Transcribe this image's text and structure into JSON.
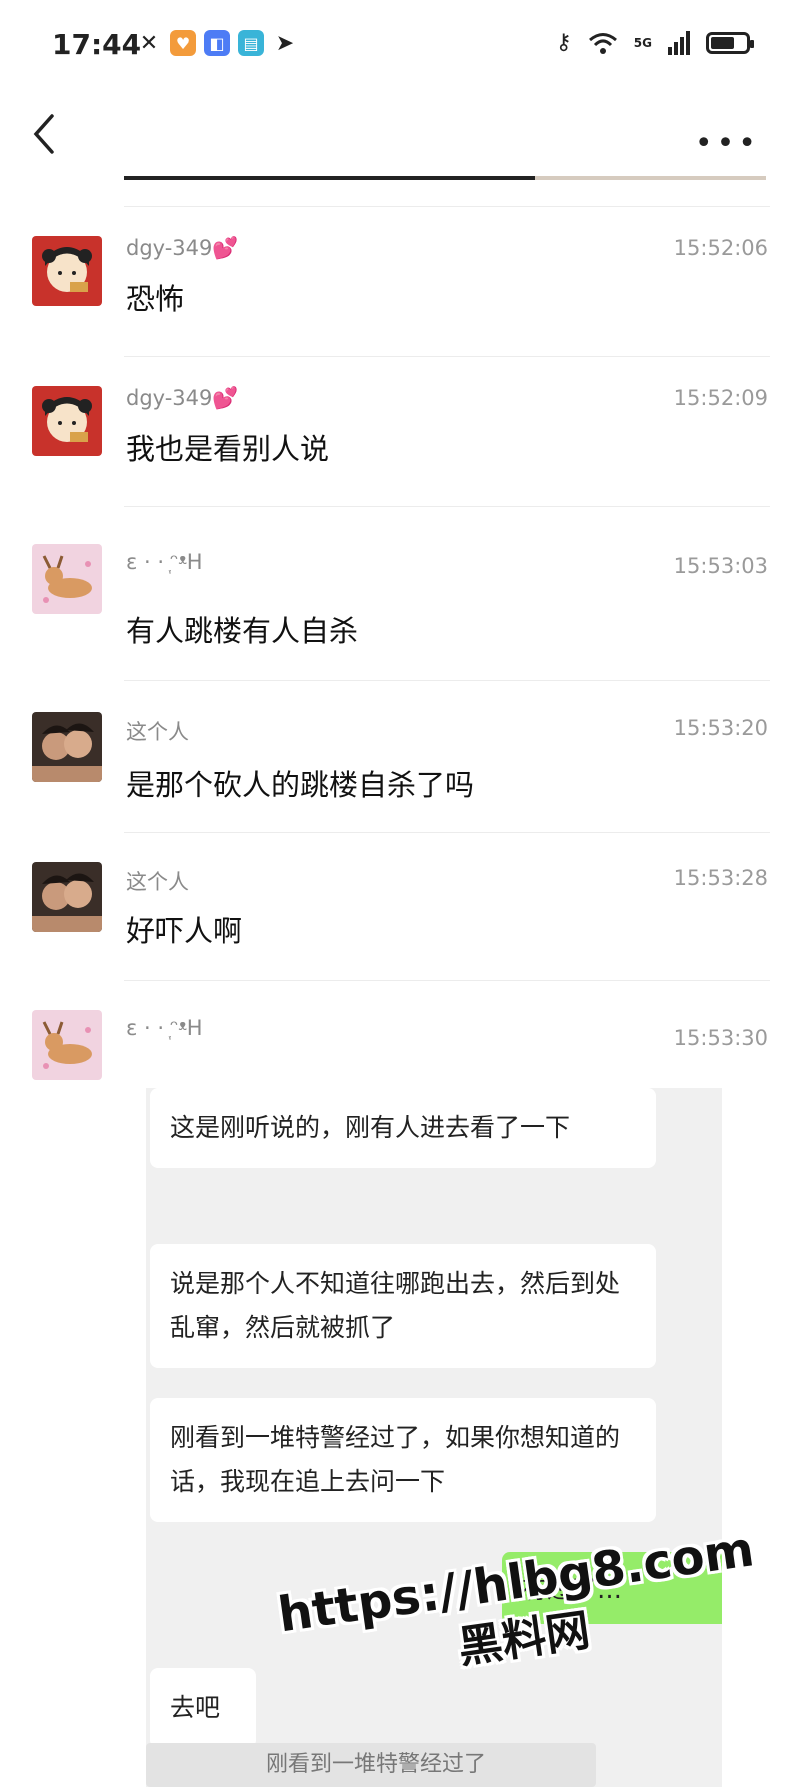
{
  "status_bar": {
    "time": "17:44",
    "network": "5G",
    "battery_level": 0.7,
    "icons": [
      "missed-call-icon",
      "shield-app-icon",
      "blue-app-icon",
      "book-app-icon",
      "telegram-icon",
      "key-icon",
      "wifi-icon",
      "signal-icon",
      "battery-icon"
    ]
  },
  "nav": {
    "more_label": "•••",
    "video_progress": 0.64
  },
  "messages": [
    {
      "sender": "dgy-349💕",
      "time": "15:52:06",
      "text": "恐怖",
      "avatar": "cartoon-girl"
    },
    {
      "sender": "dgy-349💕",
      "time": "15:52:09",
      "text": "我也是看别人说",
      "avatar": "cartoon-girl"
    },
    {
      "sender": "ɛ ·  · ᷂ᵔᵜH",
      "time": "15:53:03",
      "text": "有人跳楼有人自杀",
      "avatar": "deer-pink"
    },
    {
      "sender": "这个人",
      "time": "15:53:20",
      "text": "是那个砍人的跳楼自杀了吗",
      "avatar": "photo-couple"
    },
    {
      "sender": "这个人",
      "time": "15:53:28",
      "text": "好吓人啊",
      "avatar": "photo-couple"
    },
    {
      "sender": "ɛ ·  · ᷂ᵔᵜH",
      "time": "15:53:30",
      "text": "",
      "avatar": "deer-pink"
    }
  ],
  "forwarded": {
    "bubbles": [
      "这是刚听说的，刚有人进去看了一下",
      "说是那个人不知道往哪跑出去，然后到处乱窜，然后就被抓了",
      "刚看到一堆特警经过了，如果你想知道的话，我现在追上去问一下"
    ],
    "green_bubble": "有过了…",
    "reply": "去吧",
    "quote": "刚看到一堆特警经过了"
  },
  "watermark": {
    "url": "https://hlbg8.com",
    "name": "黑料网"
  },
  "colors": {
    "timestamp": "#9a9a9a",
    "sender": "#8a8a8a",
    "green_bubble": "#95ec69",
    "panel_bg": "#f0f0f0"
  }
}
